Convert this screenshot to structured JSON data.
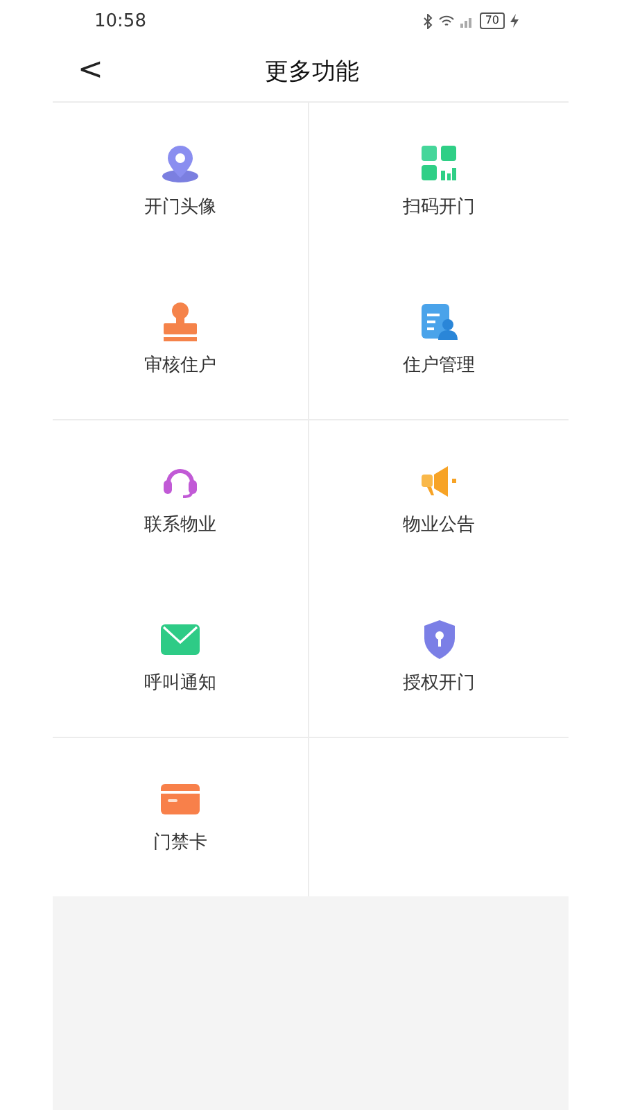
{
  "status_bar": {
    "time": "10:58",
    "battery": "70"
  },
  "header": {
    "back": "<",
    "title": "更多功能"
  },
  "sections": [
    {
      "items": [
        {
          "label": "开门头像",
          "kind": "pin"
        },
        {
          "label": "扫码开门",
          "kind": "grid"
        },
        {
          "label": "审核住户",
          "kind": "stamp"
        },
        {
          "label": "住户管理",
          "kind": "doc"
        }
      ]
    },
    {
      "items": [
        {
          "label": "联系物业",
          "kind": "headset"
        },
        {
          "label": "物业公告",
          "kind": "megaphone"
        },
        {
          "label": "呼叫通知",
          "kind": "mail"
        },
        {
          "label": "授权开门",
          "kind": "shield"
        }
      ]
    },
    {
      "items": [
        {
          "label": "门禁卡",
          "kind": "card"
        }
      ]
    }
  ]
}
